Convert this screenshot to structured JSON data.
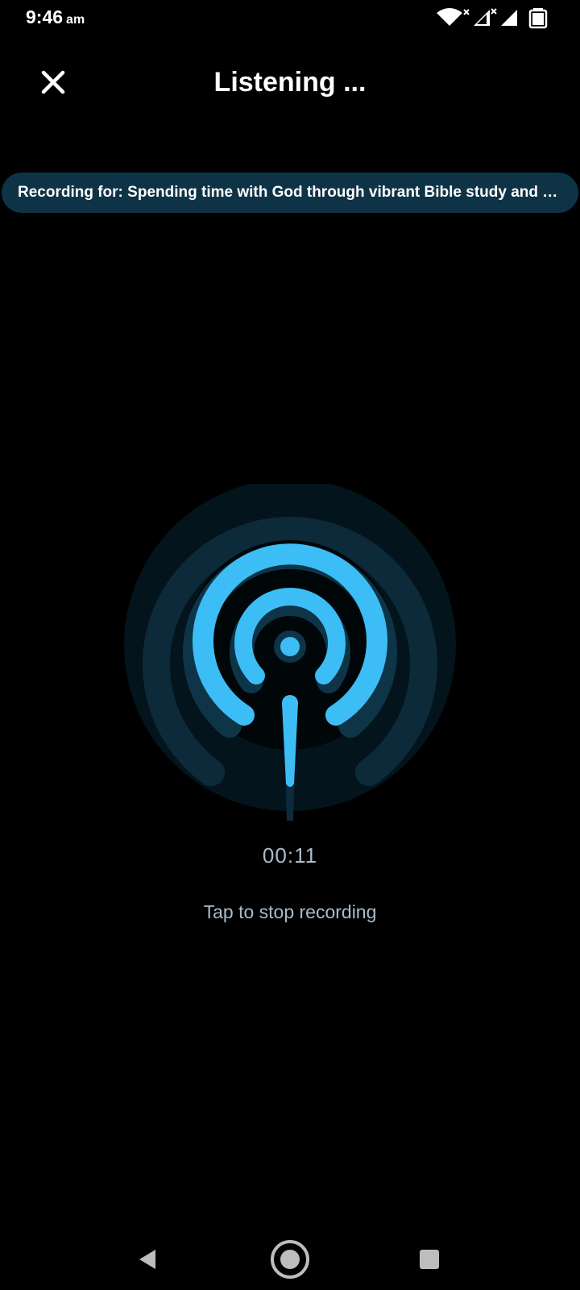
{
  "status_bar": {
    "time": "9:46",
    "ampm": "am",
    "icons": [
      "wifi-icon",
      "signal-icon",
      "signal-icon",
      "battery-icon"
    ]
  },
  "header": {
    "title": "Listening ...",
    "close_icon": "close-icon"
  },
  "recording": {
    "label": "Recording for: Spending time with God through vibrant Bible study and prayer"
  },
  "recorder": {
    "icon": "broadcast-icon",
    "elapsed": "00:11",
    "hint": "Tap to stop recording"
  },
  "nav": {
    "back_icon": "back-triangle-icon",
    "home_icon": "home-circle-icon",
    "recents_icon": "recents-square-icon"
  },
  "colors": {
    "background": "#000000",
    "accent": "#3dbdf5",
    "pill": "#0f3346",
    "muted_text": "#a9bccb"
  }
}
